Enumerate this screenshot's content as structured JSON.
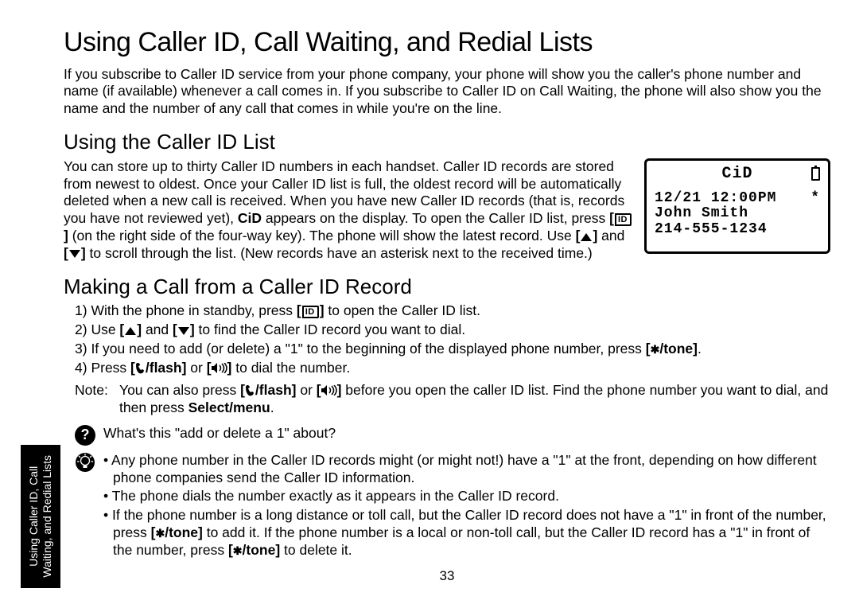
{
  "title": "Using  Caller ID, Call Waiting, and Redial Lists",
  "intro": "If you subscribe to Caller ID service from your phone company, your phone will show you the caller's phone number and name (if available) whenever a call comes in. If you subscribe to Caller ID on Call Waiting, the phone will also show you the name and the number of any call that comes in while you're on the line.",
  "section1": {
    "heading": "Using the Caller ID List",
    "body_part1": "You can store up to thirty Caller ID numbers in each handset. Caller ID records are stored from newest to oldest. Once your Caller ID list is full, the oldest record will be automatically deleted when a new call is received. When you have new Caller ID records (that is, records you have not reviewed yet), ",
    "cid_glyph": "CiD",
    "body_part2": " appears on the display.",
    "body_line2a": "To open the Caller ID list, press ",
    "key_id": "ID",
    "body_line2b": " (on the right side of the four-way key). The phone will show the latest record. Use ",
    "body_line2c": " and ",
    "body_line2d": " to scroll through the list. (New records have an asterisk next to the received time.)"
  },
  "lcd": {
    "title": "CiD",
    "date": "12/21",
    "time": "12:00PM",
    "star": "*",
    "name": "John Smith",
    "number": "214-555-1234"
  },
  "section2": {
    "heading": "Making a Call from a Caller ID    Record",
    "steps": [
      {
        "n": "1)",
        "a": "With the phone in standby, press ",
        "key": "ID",
        "b": " to open the Caller ID list."
      },
      {
        "n": "2)",
        "a": "Use ",
        "b": " and ",
        "c": " to find the Caller ID record you want to dial."
      },
      {
        "n": "3)",
        "a": "If you need to add (or delete) a \"1\" to the beginning of the displayed phone number, press ",
        "key": "/tone",
        "b": "."
      },
      {
        "n": "4)",
        "a": "Press ",
        "key1": "/flash",
        "b": " or ",
        "c": " to dial the number."
      }
    ],
    "note_label": "Note:",
    "note_a": "You can also press ",
    "note_key1": "/flash",
    "note_b": " or ",
    "note_c": " before you open the caller ID list. Find the phone number you want to dial, and then press ",
    "note_select": "Select/menu",
    "note_d": "."
  },
  "info": {
    "q": "What's this \"add or delete a 1\" about?",
    "bullets": [
      "Any phone number in the Caller ID records might (or might not!) have a \"1\" at the front, depending on how different phone companies send the Caller ID information.",
      "The phone dials the number exactly as it appears in the Caller ID record."
    ],
    "bullet3_a": "If the phone number is a long distance or toll call, but the Caller ID record does not have a \"1\" in front of the number, press ",
    "bullet3_key": "/tone",
    "bullet3_b": " to add it. If the phone number is a local or non-toll call, but the Caller ID record has a \"1\" in front of the number, press ",
    "bullet3_c": " to delete it."
  },
  "sidebar": "Using Caller ID, Call\nWaiting, and Redial Lists",
  "page_number": "33"
}
